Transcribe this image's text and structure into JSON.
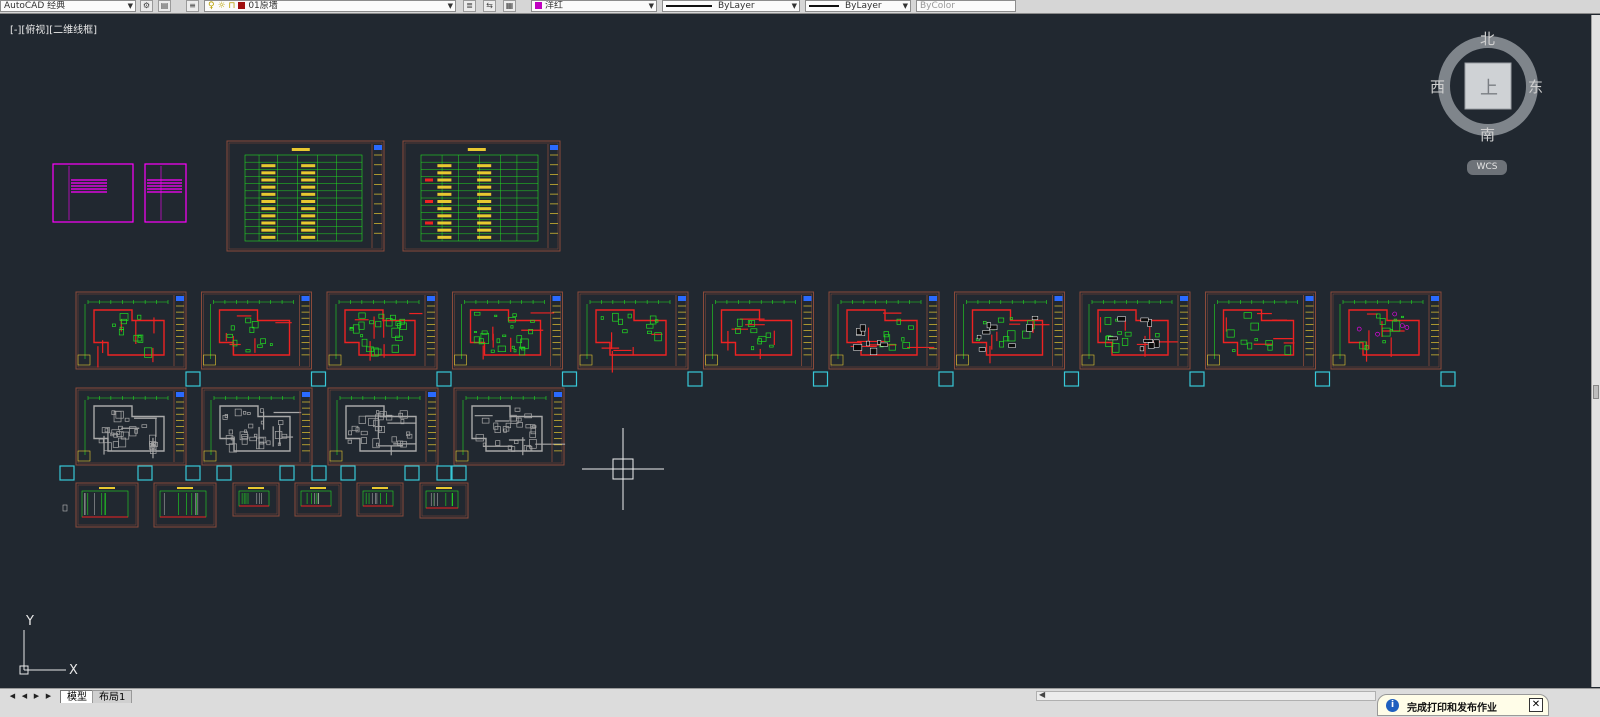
{
  "toolbar": {
    "workspace": "AutoCAD 经典",
    "layer": "01原墙",
    "color": "洋红",
    "color_hex": "#c000c0",
    "layer_color_hex": "#a01010",
    "linetype": "ByLayer",
    "lineweight": "ByLayer",
    "plotstyle": "ByColor"
  },
  "viewport": {
    "label": "[-][俯视][二维线框]"
  },
  "viewcube": {
    "north": "北",
    "south": "南",
    "east": "东",
    "west": "西",
    "top_face": "上",
    "wcs": "WCS"
  },
  "ucs": {
    "x_label": "X",
    "y_label": "Y"
  },
  "tabs": {
    "model": "模型",
    "layout1": "布局1"
  },
  "notification": {
    "info_icon": "i",
    "message": "完成打印和发布作业",
    "close": "✕"
  },
  "colors": {
    "background": "#212830",
    "sheet_frame": "#8a4a3a",
    "plan_green": "#22dd22",
    "plan_red": "#ee2222",
    "plan_yellow": "#e8c830",
    "plan_gray": "#a8a8a8",
    "title_block_blue": "#2a6aff",
    "magenta": "#ff00ff",
    "selection_cyan": "#38c8d8",
    "crosshair": "#f0f0f0"
  },
  "sheets": {
    "cover_sheets": 2,
    "table_sheets": 2,
    "plan_row_1": 11,
    "plan_row_2": 4,
    "elevation_sheets": 6
  }
}
